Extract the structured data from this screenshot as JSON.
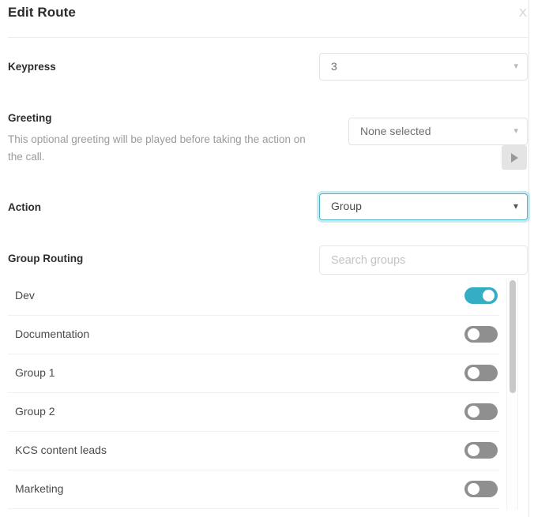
{
  "dialog": {
    "title": "Edit Route",
    "close_icon": "close-icon",
    "close_label": "X"
  },
  "fields": {
    "keypress": {
      "label": "Keypress",
      "value": "3",
      "chevron": "chevron-down-icon"
    },
    "greeting": {
      "label": "Greeting",
      "help": "This optional greeting will be played before taking the action on the call.",
      "value": "None selected",
      "chevron": "chevron-down-icon",
      "play_icon": "play-icon"
    },
    "action": {
      "label": "Action",
      "value": "Group",
      "chevron": "chevron-down-icon",
      "focus_color": "#4ab3c6"
    },
    "group_routing": {
      "label": "Group Routing",
      "search_placeholder": "Search groups"
    }
  },
  "groups": [
    {
      "name": "Dev",
      "enabled": true
    },
    {
      "name": "Documentation",
      "enabled": false
    },
    {
      "name": "Group 1",
      "enabled": false
    },
    {
      "name": "Group 2",
      "enabled": false
    },
    {
      "name": "KCS content leads",
      "enabled": false
    },
    {
      "name": "Marketing",
      "enabled": false
    }
  ],
  "colors": {
    "toggle_on": "#35aec4",
    "toggle_off": "#8f8f8f",
    "accent": "#4ab3c6"
  }
}
